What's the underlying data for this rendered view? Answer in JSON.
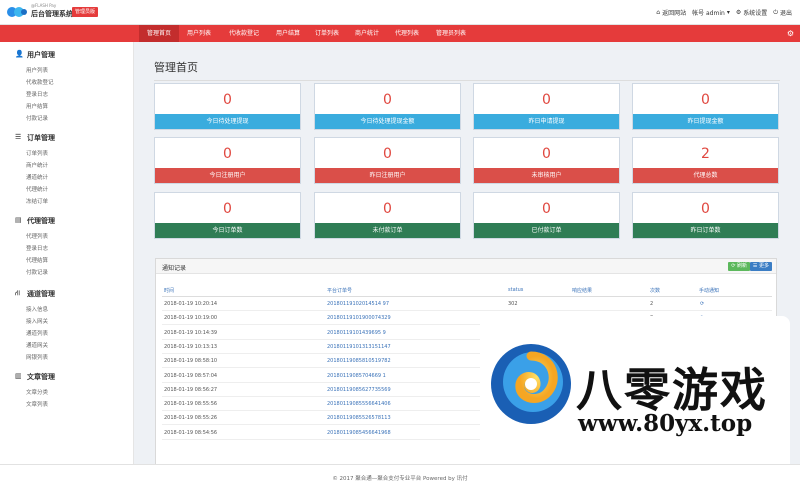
{
  "header": {
    "brand_sub": "@FLASH Pay",
    "brand": "后台管理系统",
    "badge": "管理员版",
    "links": {
      "home": "返回网站",
      "account": "帐号 admin",
      "settings": "系统设置",
      "logout": "退出"
    }
  },
  "nav": {
    "items": [
      "管理首页",
      "用户列表",
      "代收款登记",
      "用户结算",
      "订单列表",
      "商户统计",
      "代理列表",
      "管理员列表"
    ],
    "active_index": 0
  },
  "sidebar": {
    "sections": [
      {
        "title": "用户管理",
        "icon": "user-icon",
        "items": [
          "用户列表",
          "代收款登记",
          "登录日志",
          "用户结算",
          "付款记录"
        ]
      },
      {
        "title": "订单管理",
        "icon": "list-icon",
        "items": [
          "订单列表",
          "商户统计",
          "通道统计",
          "代理统计",
          "冻结订单"
        ]
      },
      {
        "title": "代理管理",
        "icon": "document-icon",
        "items": [
          "代理列表",
          "登录日志",
          "代理结算",
          "付款记录"
        ]
      },
      {
        "title": "通道管理",
        "icon": "road-icon",
        "items": [
          "接入信息",
          "接入网关",
          "通道列表",
          "通道网关",
          "网银列表"
        ]
      },
      {
        "title": "文章管理",
        "icon": "book-icon",
        "items": [
          "文章分类",
          "文章列表"
        ]
      }
    ]
  },
  "main": {
    "title": "管理首页",
    "stats": [
      {
        "value": "0",
        "label": "今日待处理提现",
        "color": "blue"
      },
      {
        "value": "0",
        "label": "今日待处理提现金额",
        "color": "blue"
      },
      {
        "value": "0",
        "label": "昨日申请提现",
        "color": "blue"
      },
      {
        "value": "0",
        "label": "昨日提现金额",
        "color": "blue"
      },
      {
        "value": "0",
        "label": "今日注册用户",
        "color": "red"
      },
      {
        "value": "0",
        "label": "昨日注册用户",
        "color": "red"
      },
      {
        "value": "0",
        "label": "未审核用户",
        "color": "red"
      },
      {
        "value": "2",
        "label": "代理总数",
        "color": "red"
      },
      {
        "value": "0",
        "label": "今日订单数",
        "color": "green"
      },
      {
        "value": "0",
        "label": "未付款订单",
        "color": "green"
      },
      {
        "value": "0",
        "label": "已付款订单",
        "color": "green"
      },
      {
        "value": "0",
        "label": "昨日订单数",
        "color": "green"
      }
    ]
  },
  "notify": {
    "title": "通知记录",
    "refresh_label": "刷新",
    "more_label": "更多",
    "headers": [
      "时间",
      "平台订单号",
      "status",
      "响应结果",
      "次数",
      "手动通知"
    ],
    "rows": [
      {
        "time": "2018-01-19 10:20:14",
        "order": "20180119102014514 97",
        "status": "302",
        "count": "2"
      },
      {
        "time": "2018-01-19 10:19:00",
        "order": "20180119101900074329",
        "status": "",
        "count": "0"
      },
      {
        "time": "2018-01-19 10:14:39",
        "order": "20180119101439695 9",
        "status": "",
        "count": ""
      },
      {
        "time": "2018-01-19 10:13:13",
        "order": "20180119101313151147",
        "status": "",
        "count": ""
      },
      {
        "time": "2018-01-19 08:58:10",
        "order": "20180119085810519782",
        "status": "",
        "count": ""
      },
      {
        "time": "2018-01-19 08:57:04",
        "order": "20180119085704669 1",
        "status": "",
        "count": ""
      },
      {
        "time": "2018-01-19 08:56:27",
        "order": "20180119085627735569",
        "status": "",
        "count": ""
      },
      {
        "time": "2018-01-19 08:55:56",
        "order": "20180119085556641406",
        "status": "",
        "count": ""
      },
      {
        "time": "2018-01-19 08:55:26",
        "order": "20180119085526578113",
        "status": "",
        "count": ""
      },
      {
        "time": "2018-01-19 08:54:56",
        "order": "20180119085456641968",
        "status": "",
        "count": ""
      }
    ]
  },
  "footer": {
    "text": "© 2017 聚合通—聚合支付专业平台 Powered by 讯付"
  },
  "watermark": {
    "title": "八零游戏",
    "url": "www.80yx.top"
  },
  "colors": {
    "accent": "#e53b3b",
    "blue": "#3aacde",
    "red": "#da4f49",
    "green": "#2f7d55"
  }
}
